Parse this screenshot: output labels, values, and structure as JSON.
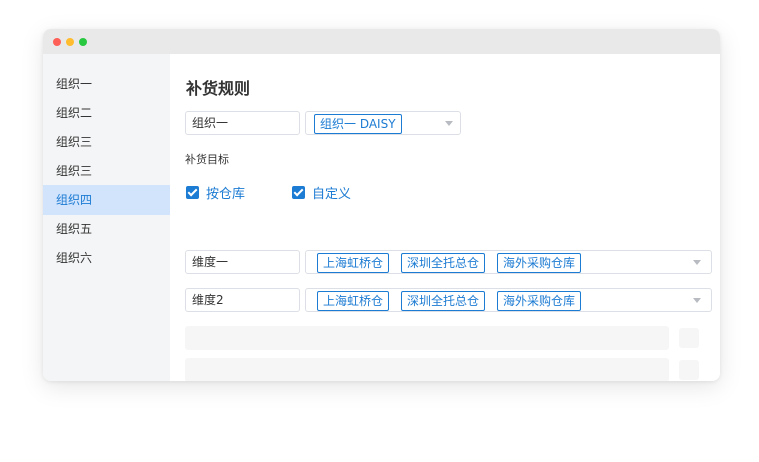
{
  "sidebar": {
    "items": [
      {
        "label": "组织一",
        "active": false
      },
      {
        "label": "组织二",
        "active": false
      },
      {
        "label": "组织三",
        "active": false
      },
      {
        "label": "组织三",
        "active": false
      },
      {
        "label": "组织四",
        "active": true
      },
      {
        "label": "组织五",
        "active": false
      },
      {
        "label": "组织六",
        "active": false
      }
    ]
  },
  "main": {
    "title": "补货规则",
    "org_input": {
      "value": "组织一"
    },
    "org_select": {
      "selected_tag": "组织一 DAISY"
    },
    "target_label": "补货目标",
    "checkboxes": [
      {
        "label": "按仓库",
        "checked": true
      },
      {
        "label": "自定义",
        "checked": true
      }
    ],
    "dimensions": [
      {
        "name": "维度一",
        "tags": [
          "上海虹桥仓",
          "深圳全托总仓",
          "海外采购仓库"
        ],
        "action": "add"
      },
      {
        "name": "维度2",
        "tags": [
          "上海虹桥仓",
          "深圳全托总仓",
          "海外采购仓库"
        ],
        "action": "remove"
      }
    ]
  },
  "colors": {
    "accent": "#1c7bd3",
    "active_bg": "#d2e4fc",
    "sidebar_bg": "#f4f5f6",
    "titlebar_bg": "#e9e9e9"
  },
  "icons": [
    "window-close-dot",
    "window-minimize-dot",
    "window-maximize-dot",
    "caret-down-icon",
    "checkmark-icon",
    "plus-circle-icon",
    "minus-circle-icon"
  ]
}
